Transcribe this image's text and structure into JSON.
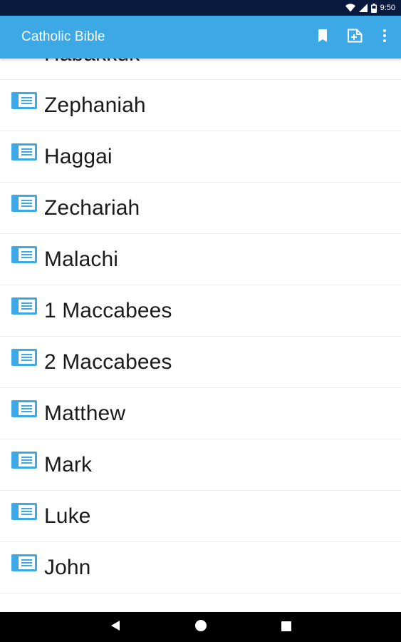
{
  "status_bar": {
    "time": "9:50",
    "icons": [
      "wifi-icon",
      "cell-signal-icon",
      "battery-icon"
    ]
  },
  "app_bar": {
    "title": "Catholic Bible",
    "actions": [
      "bookmark-icon",
      "add-note-icon",
      "more-vert-icon"
    ],
    "background": "#3da8e6"
  },
  "books": [
    {
      "label": "Habakkuk"
    },
    {
      "label": "Zephaniah"
    },
    {
      "label": "Haggai"
    },
    {
      "label": "Zechariah"
    },
    {
      "label": "Malachi"
    },
    {
      "label": "1 Maccabees"
    },
    {
      "label": "2 Maccabees"
    },
    {
      "label": "Matthew"
    },
    {
      "label": "Mark"
    },
    {
      "label": "Luke"
    },
    {
      "label": "John"
    }
  ],
  "list_icon": {
    "name": "book-icon",
    "color": "#3da8e6"
  },
  "nav_bar": {
    "buttons": [
      "back-icon",
      "home-icon",
      "recents-icon"
    ]
  }
}
